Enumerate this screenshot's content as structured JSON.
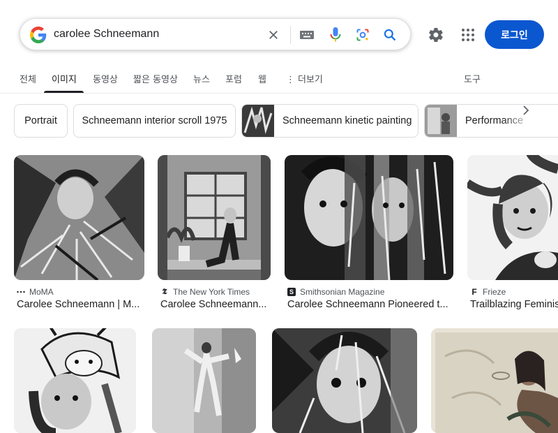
{
  "search": {
    "query": "carolee Schneemann"
  },
  "header": {
    "login_label": "로그인"
  },
  "tabs": [
    {
      "label": "전체"
    },
    {
      "label": "이미지"
    },
    {
      "label": "동영상"
    },
    {
      "label": "짧은 동영상"
    },
    {
      "label": "뉴스"
    },
    {
      "label": "포럼"
    },
    {
      "label": "웹"
    },
    {
      "label": "더보기"
    },
    {
      "label": "도구"
    }
  ],
  "chips": [
    {
      "label": "Portrait"
    },
    {
      "label": "Schneemann interior scroll 1975"
    },
    {
      "label": "Schneemann kinetic painting"
    },
    {
      "label": "Performance"
    }
  ],
  "results": [
    {
      "source": "MoMA",
      "title": "Carolee Schneemann | M..."
    },
    {
      "source": "The New York Times",
      "title": "Carolee Schneemann..."
    },
    {
      "source": "Smithsonian Magazine",
      "title": "Carolee Schneemann Pioneered t..."
    },
    {
      "source": "Frieze",
      "title": "Trailblazing Feminis"
    }
  ],
  "colors": {
    "accent": "#0b57d0",
    "text": "#202124",
    "secondary_text": "#4d5156"
  }
}
